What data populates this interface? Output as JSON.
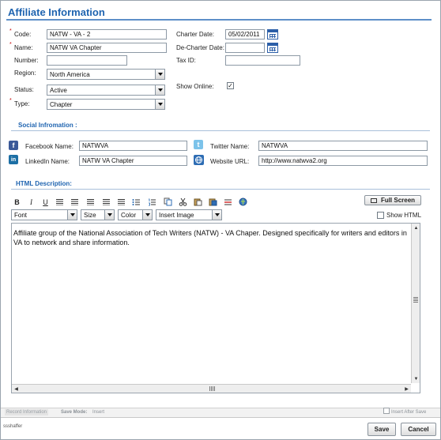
{
  "header": {
    "title": "Affiliate Information"
  },
  "form": {
    "code": {
      "label": "Code:",
      "value": "NATW - VA - 2"
    },
    "name": {
      "label": "Name:",
      "value": "NATW VA Chapter"
    },
    "number": {
      "label": "Number:",
      "value": ""
    },
    "region": {
      "label": "Region:",
      "value": "North America"
    },
    "status": {
      "label": "Status:",
      "value": "Active"
    },
    "type": {
      "label": "Type:",
      "value": "Chapter"
    },
    "charter_date": {
      "label": "Charter Date:",
      "value": "05/02/2011"
    },
    "decharter_date": {
      "label": "De-Charter Date:",
      "value": ""
    },
    "tax_id": {
      "label": "Tax ID:",
      "value": ""
    },
    "show_online": {
      "label": "Show Online:",
      "checked": true,
      "mark": "✓"
    },
    "required_marker": "*"
  },
  "social": {
    "title": "Social Infromation :",
    "facebook": {
      "label": "Facebook Name:",
      "value": "NATWVA",
      "icon": "facebook-icon",
      "glyph": "f",
      "color": "#3b5998"
    },
    "twitter": {
      "label": "Twitter Name:",
      "value": "NATWVA",
      "icon": "twitter-icon",
      "glyph": "t",
      "color": "#4aa3df"
    },
    "linkedin": {
      "label": "LinkedIn Name:",
      "value": "NATW VA Chapter",
      "icon": "linkedin-icon",
      "glyph": "in",
      "color": "#1d6fa5"
    },
    "website": {
      "label": "Website URL:",
      "value": "http://www.natwva2.org",
      "icon": "globe-icon",
      "color": "#2e6db4"
    }
  },
  "html_description": {
    "title": "HTML Description:",
    "full_screen_label": "Full Screen",
    "show_html_label": "Show HTML",
    "toolbar": {
      "bold": "B",
      "italic": "I",
      "underline": "U",
      "font": "Font",
      "size": "Size",
      "color": "Color",
      "insert_image": "Insert Image"
    },
    "content": "Affiliate group of the National Association of Tech Writers (NATW) - VA Chaper.  Designed specifically for writers and editors in VA to network and share information."
  },
  "status_bar": {
    "record_info": "Record Information",
    "save_mode_label": "Save Mode:",
    "save_mode_value": "Insert",
    "insert_after_save": "Insert After Save"
  },
  "footer": {
    "user": "ssshaffer",
    "save_label": "Save",
    "cancel_label": "Cancel"
  },
  "colors": {
    "accent": "#1f64b0",
    "required": "#c40000"
  }
}
